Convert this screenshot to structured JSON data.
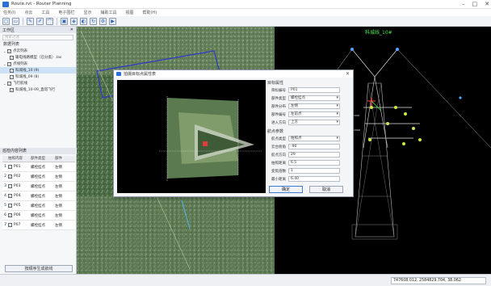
{
  "window": {
    "title": "Route.rvt - Router Planning"
  },
  "menu": [
    "任务(I)",
    "点云",
    "工具",
    "电子围栏",
    "显示",
    "辅助工具",
    "视图",
    "帮助(H)"
  ],
  "toolbar": {
    "tools": [
      "new-file",
      "open-folder",
      "edit",
      "pen",
      "measure",
      "view-front",
      "view-top",
      "view-side",
      "sync",
      "settings",
      "play"
    ]
  },
  "workspace": {
    "header": "工作区",
    "search_placeholder": "搜索过滤",
    "tree_header": "数据列表",
    "tree": [
      {
        "label": "点云列表",
        "level": 1,
        "expanded": true
      },
      {
        "label": "输电线路模型（已分类）.las",
        "level": 2
      },
      {
        "label": "点线列表",
        "level": 1,
        "expanded": true
      },
      {
        "label": "科城线_10 (9)",
        "level": 2,
        "selected": true
      },
      {
        "label": "科城线_09 (8)",
        "level": 2
      },
      {
        "label": "飞行航线",
        "level": 1,
        "expanded": true
      },
      {
        "label": "科城线_10-09_直塔飞行",
        "level": 2
      }
    ]
  },
  "waypoint_list": {
    "header": "巡检内容列表",
    "columns": [
      "",
      "拍照内容",
      "部件类型",
      "部件"
    ],
    "rows": [
      {
        "no": "1",
        "name": "P01",
        "type": "螺栓挂点",
        "part": "左侧"
      },
      {
        "no": "2",
        "name": "P02",
        "type": "螺栓挂点",
        "part": "左侧"
      },
      {
        "no": "3",
        "name": "P03",
        "type": "螺栓挂点",
        "part": "左侧"
      },
      {
        "no": "4",
        "name": "P04",
        "type": "螺栓挂点",
        "part": "左侧"
      },
      {
        "no": "5",
        "name": "P05",
        "type": "螺栓挂点",
        "part": "左侧"
      },
      {
        "no": "6",
        "name": "P06",
        "type": "螺栓挂点",
        "part": "左侧"
      },
      {
        "no": "7",
        "name": "P07",
        "type": "螺栓挂点",
        "part": "左侧"
      }
    ],
    "generate_button": "按顺序生成航线"
  },
  "view3d": {
    "tower_label": "科城线_10#"
  },
  "dialog": {
    "title": "拍摄目标点属性表",
    "close": "✕",
    "target_section": "目标属性",
    "target_fields": [
      {
        "label": "目标编号",
        "value": "P01",
        "select": false
      },
      {
        "label": "部件类型",
        "value": "螺栓挂点",
        "select": true
      },
      {
        "label": "部件分布",
        "value": "左侧",
        "select": true
      },
      {
        "label": "部件编号",
        "value": "左前点",
        "select": true
      },
      {
        "label": "进入方向",
        "value": "上方",
        "select": true
      }
    ],
    "camera_section": "航点参数",
    "camera_fields": [
      {
        "label": "航点类型",
        "value": "拍照点",
        "select": true
      },
      {
        "label": "云台俯角",
        "value": "-90",
        "select": false
      },
      {
        "label": "航点方向",
        "value": "29",
        "select": false
      },
      {
        "label": "拍照距离",
        "value": "6.5",
        "select": false
      },
      {
        "label": "变焦倍数",
        "value": "1",
        "select": false
      },
      {
        "label": "最小距离",
        "value": "6.40",
        "select": false
      }
    ],
    "ok_label": "确定",
    "cancel_label": "取消"
  },
  "status": {
    "coords": "747608.012, 2584829.704, 38.062"
  }
}
